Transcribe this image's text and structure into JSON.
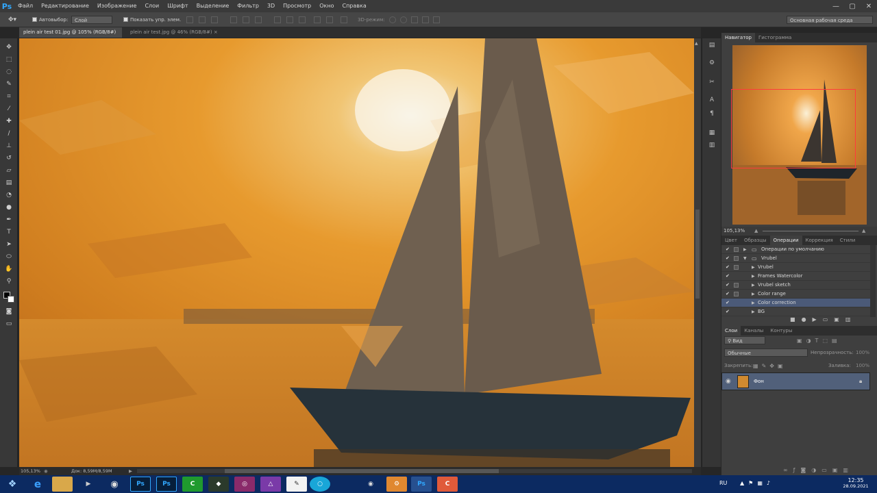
{
  "app": {
    "logo": "Ps",
    "accent": "#31a8ff"
  },
  "menu": [
    "Файл",
    "Редактирование",
    "Изображение",
    "Слои",
    "Шрифт",
    "Выделение",
    "Фильтр",
    "3D",
    "Просмотр",
    "Окно",
    "Справка"
  ],
  "window_controls": {
    "minimize": "—",
    "maximize": "▢",
    "close": "✕"
  },
  "options": {
    "autoselect_label": "Автовыбор:",
    "autoselect_value": "Слой",
    "show_controls_label": "Показать упр. элем.",
    "mode_3d_label": "3D-режим:",
    "workspace": "Основная рабочая среда"
  },
  "tabs": [
    {
      "label": "plein air test 01.jpg @ 105% (RGB/8#) *",
      "close": "×"
    },
    {
      "label": "plein air test.jpg @ 46% (RGB/8#)",
      "close": "×"
    }
  ],
  "navigator": {
    "tabs": [
      "Навигатор",
      "Гистограмма"
    ],
    "zoom": "105,13%"
  },
  "actions_panel": {
    "tabs": [
      "Цвет",
      "Образцы",
      "Операции",
      "Коррекция",
      "Стили"
    ],
    "items": [
      {
        "label": "Операции по умолчанию",
        "check": "✔",
        "level": 0
      },
      {
        "label": "Vrubel",
        "check": "✔",
        "level": 0
      },
      {
        "label": "Vrubel",
        "check": "✔",
        "level": 1
      },
      {
        "label": "Frames Watercolor",
        "check": "✔",
        "level": 1
      },
      {
        "label": "Vrubel sketch",
        "check": "✔",
        "level": 1
      },
      {
        "label": "Color range",
        "check": "✔",
        "level": 1
      },
      {
        "label": "Color correction",
        "check": "✔",
        "level": 1
      },
      {
        "label": "BG",
        "check": "✔",
        "level": 1
      }
    ]
  },
  "layers_panel": {
    "tabs": [
      "Слои",
      "Каналы",
      "Контуры"
    ],
    "filter_label": "Вид",
    "blend_mode": "Обычные",
    "opacity_label": "Непрозрачность:",
    "opacity_value": "100%",
    "lock_label": "Закрепить:",
    "fill_label": "Заливка:",
    "fill_value": "100%",
    "layer_name": "Фон"
  },
  "status": {
    "zoom": "105,13%",
    "doc": "Док: 8,59M/8,59M"
  },
  "taskbar": {
    "lang": "RU",
    "time": "12:35",
    "date": "28.09.2021",
    "apps": [
      "chrome-icon",
      "ps-icon",
      "ps-icon",
      "c-icon",
      "plugin-icon",
      "app-icon",
      "vector-icon",
      "doc-icon",
      "browser-icon",
      "camera-icon",
      "tool-icon",
      "ps-icon",
      "c-icon"
    ]
  }
}
